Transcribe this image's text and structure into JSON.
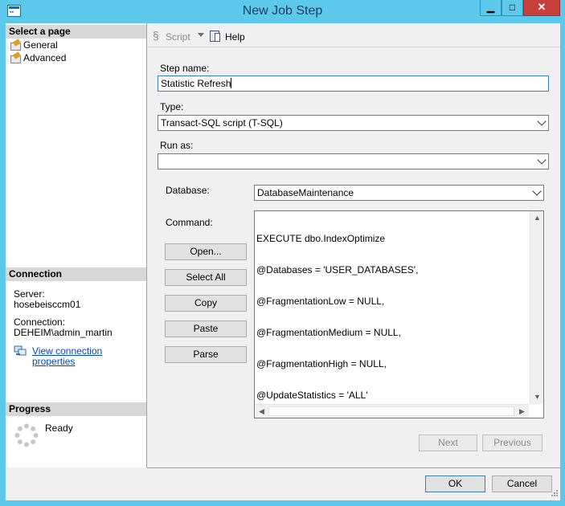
{
  "window": {
    "title": "New Job Step",
    "min_glyph": "▁",
    "max_glyph": "□",
    "close_glyph": "✕"
  },
  "left_pane": {
    "select_page_title": "Select a page",
    "pages": [
      {
        "label": "General",
        "icon": "page-icon"
      },
      {
        "label": "Advanced",
        "icon": "page-icon"
      }
    ],
    "connection": {
      "title": "Connection",
      "server_label": "Server:",
      "server_value": "hosebeisccm01",
      "connection_label": "Connection:",
      "connection_value": "DEHEIM\\admin_martin",
      "link": "View connection properties"
    },
    "progress": {
      "title": "Progress",
      "status": "Ready"
    }
  },
  "toolbar": {
    "script_label": "Script",
    "help_label": "Help"
  },
  "form": {
    "step_name_label": "Step name:",
    "step_name_value": "Statistic Refresh",
    "type_label": "Type:",
    "type_value": "Transact-SQL script (T-SQL)",
    "run_as_label": "Run as:",
    "run_as_value": "",
    "database_label": "Database:",
    "database_value": "DatabaseMaintenance",
    "command_label": "Command:",
    "command_lines": [
      "EXECUTE dbo.IndexOptimize",
      "@Databases = 'USER_DATABASES',",
      "@FragmentationLow = NULL,",
      "@FragmentationMedium = NULL,",
      "@FragmentationHigh = NULL,",
      "@UpdateStatistics = 'ALL'"
    ],
    "buttons": {
      "open": "Open...",
      "select_all": "Select All",
      "copy": "Copy",
      "paste": "Paste",
      "parse": "Parse"
    }
  },
  "nav": {
    "next": "Next",
    "previous": "Previous"
  },
  "dialog": {
    "ok": "OK",
    "cancel": "Cancel"
  }
}
